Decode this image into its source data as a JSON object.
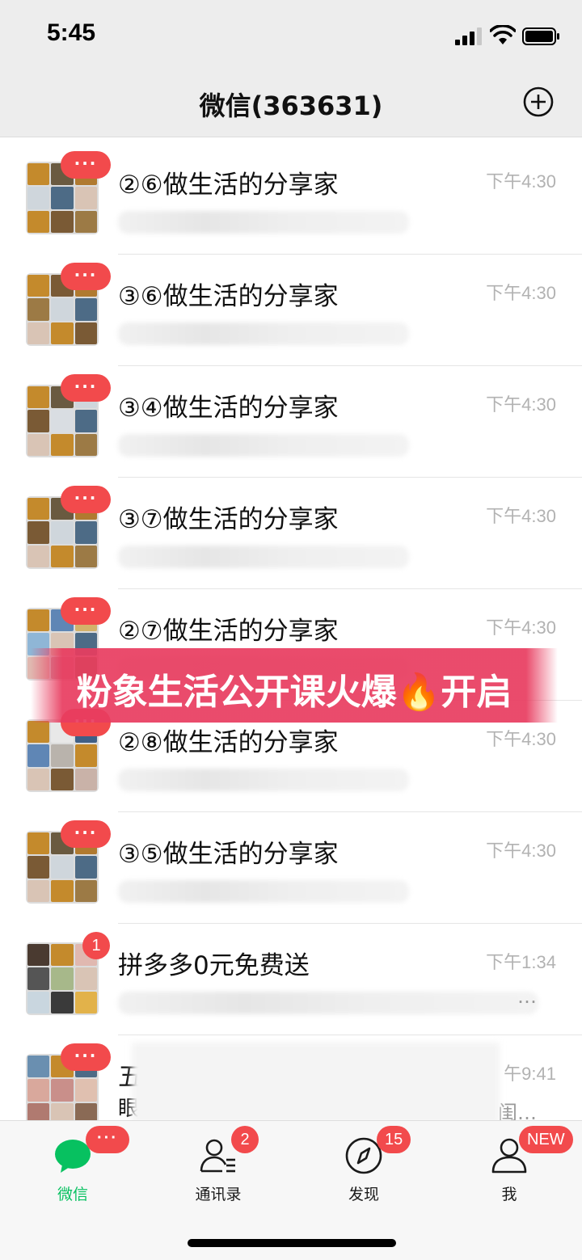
{
  "status_bar": {
    "time": "5:45"
  },
  "header": {
    "title": "微信(363631)"
  },
  "chats": [
    {
      "name": "②⑥做生活的分享家",
      "time": "下午4:30",
      "badge": "···"
    },
    {
      "name": "③⑥做生活的分享家",
      "time": "下午4:30",
      "badge": "···"
    },
    {
      "name": "③④做生活的分享家",
      "time": "下午4:30",
      "badge": "···"
    },
    {
      "name": "③⑦做生活的分享家",
      "time": "下午4:30",
      "badge": "···"
    },
    {
      "name": "②⑦做生活的分享家",
      "time": "下午4:30",
      "badge": "···"
    },
    {
      "name": "②⑧做生活的分享家",
      "time": "下午4:30",
      "badge": "···"
    },
    {
      "name": "③⑤做生活的分享家",
      "time": "下午4:30",
      "badge": "···"
    },
    {
      "name": "拼多多0元免费送",
      "time": "下午1:34",
      "badge": "1",
      "preview_tail": "…"
    },
    {
      "name": "五",
      "time": "午9:41",
      "badge": "···",
      "preview_head": "眼",
      "preview_tail": "闺…"
    }
  ],
  "promo_banner": {
    "text": "粉象生活公开课火爆🔥开启"
  },
  "tab_bar": {
    "tabs": [
      {
        "label": "微信",
        "badge": "···",
        "icon": "chat-bubble-icon",
        "active": true
      },
      {
        "label": "通讯录",
        "badge": "2",
        "icon": "contacts-icon"
      },
      {
        "label": "发现",
        "badge": "15",
        "icon": "compass-icon"
      },
      {
        "label": "我",
        "badge": "NEW",
        "icon": "person-icon"
      }
    ]
  },
  "colors": {
    "accent": "#07c160",
    "badge": "#f24a4c",
    "banner": "#e83c5f"
  }
}
